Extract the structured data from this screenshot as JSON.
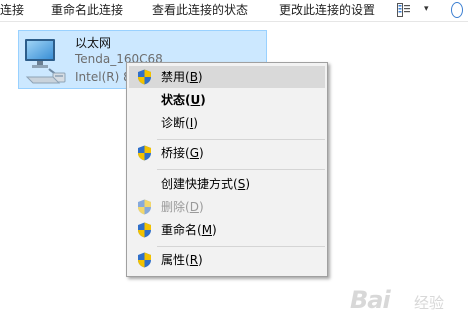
{
  "toolbar": {
    "commands": [
      "连接",
      "重命名此连接",
      "查看此连接的状态",
      "更改此连接的设置"
    ],
    "view_icon": "view-options-icon",
    "caret": "▾",
    "more_icon": "help-icon"
  },
  "adapter": {
    "name": "以太网",
    "network": "Tenda_160C68",
    "device": "Intel(R) 8",
    "icon": "network-adapter-icon"
  },
  "context_menu": {
    "items": [
      {
        "label": "禁用(B)",
        "pre": "禁用(",
        "key": "B",
        "post": ")",
        "shield": true,
        "highlighted": true
      },
      {
        "label": "状态(U)",
        "pre": "状态(",
        "key": "U",
        "post": ")",
        "bold": true
      },
      {
        "label": "诊断(I)",
        "pre": "诊断(",
        "key": "I",
        "post": ")"
      },
      {
        "label": "桥接(G)",
        "pre": "桥接(",
        "key": "G",
        "post": ")",
        "shield": true
      },
      {
        "label": "创建快捷方式(S)",
        "pre": "创建快捷方式(",
        "key": "S",
        "post": ")"
      },
      {
        "label": "删除(D)",
        "pre": "删除(",
        "key": "D",
        "post": ")",
        "shield": true,
        "disabled": true
      },
      {
        "label": "重命名(M)",
        "pre": "重命名(",
        "key": "M",
        "post": ")",
        "shield": true
      },
      {
        "label": "属性(R)",
        "pre": "属性(",
        "key": "R",
        "post": ")",
        "shield": true
      }
    ]
  },
  "watermark": {
    "text": "Bai",
    "sub": "经验"
  },
  "colors": {
    "tile_bg": "#cce8ff",
    "tile_border": "#99d1ff",
    "menu_bg": "#f2f2f2",
    "menu_highlight": "#d9d9d9",
    "shield_blue": "#2f6fc9",
    "shield_gold": "#f2c200"
  }
}
